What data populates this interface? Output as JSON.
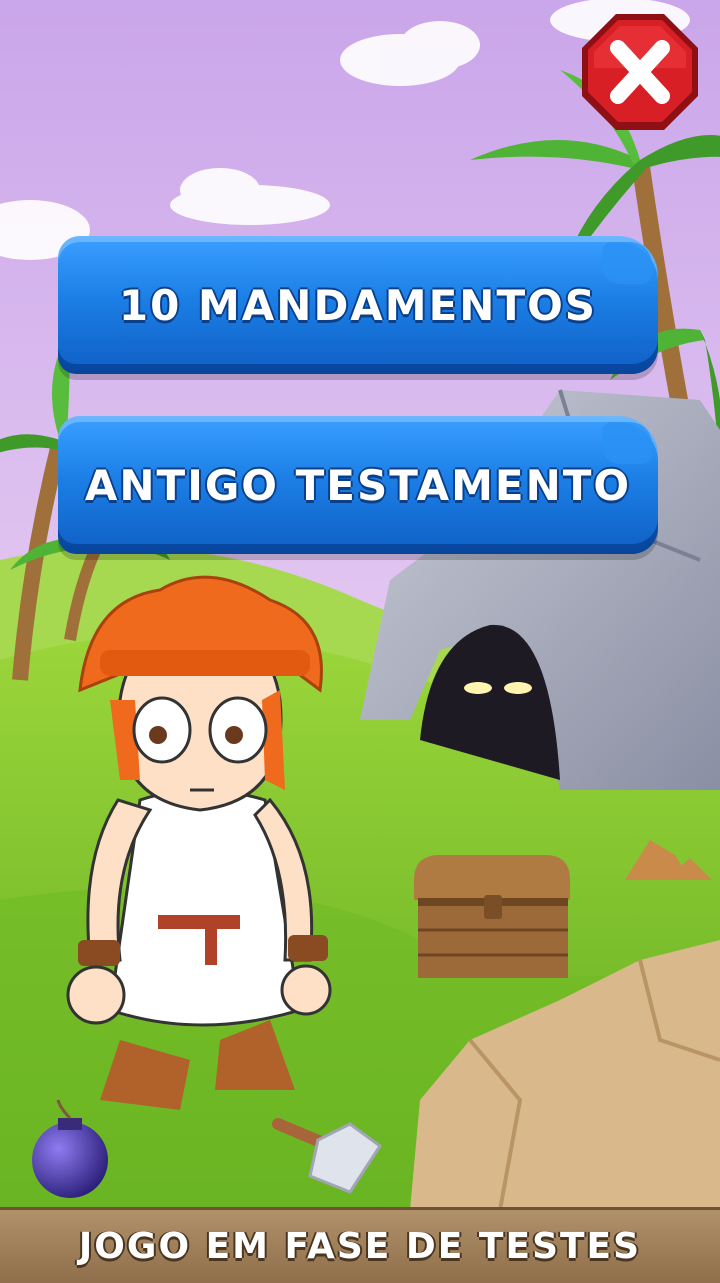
{
  "menu": {
    "items": [
      {
        "label": "10 MANDAMENTOS"
      },
      {
        "label": "ANTIGO TESTAMENTO"
      }
    ]
  },
  "close": {
    "icon": "close-x-icon",
    "color": "#d81f26"
  },
  "footer": {
    "text": "JOGO EM FASE DE TESTES"
  },
  "colors": {
    "sky_top": "#c9a7e8",
    "sky_bottom": "#f1d9f5",
    "grass": "#7fc52a",
    "button_blue": "#1c7fe6",
    "footer_brown": "#9c7b57"
  }
}
